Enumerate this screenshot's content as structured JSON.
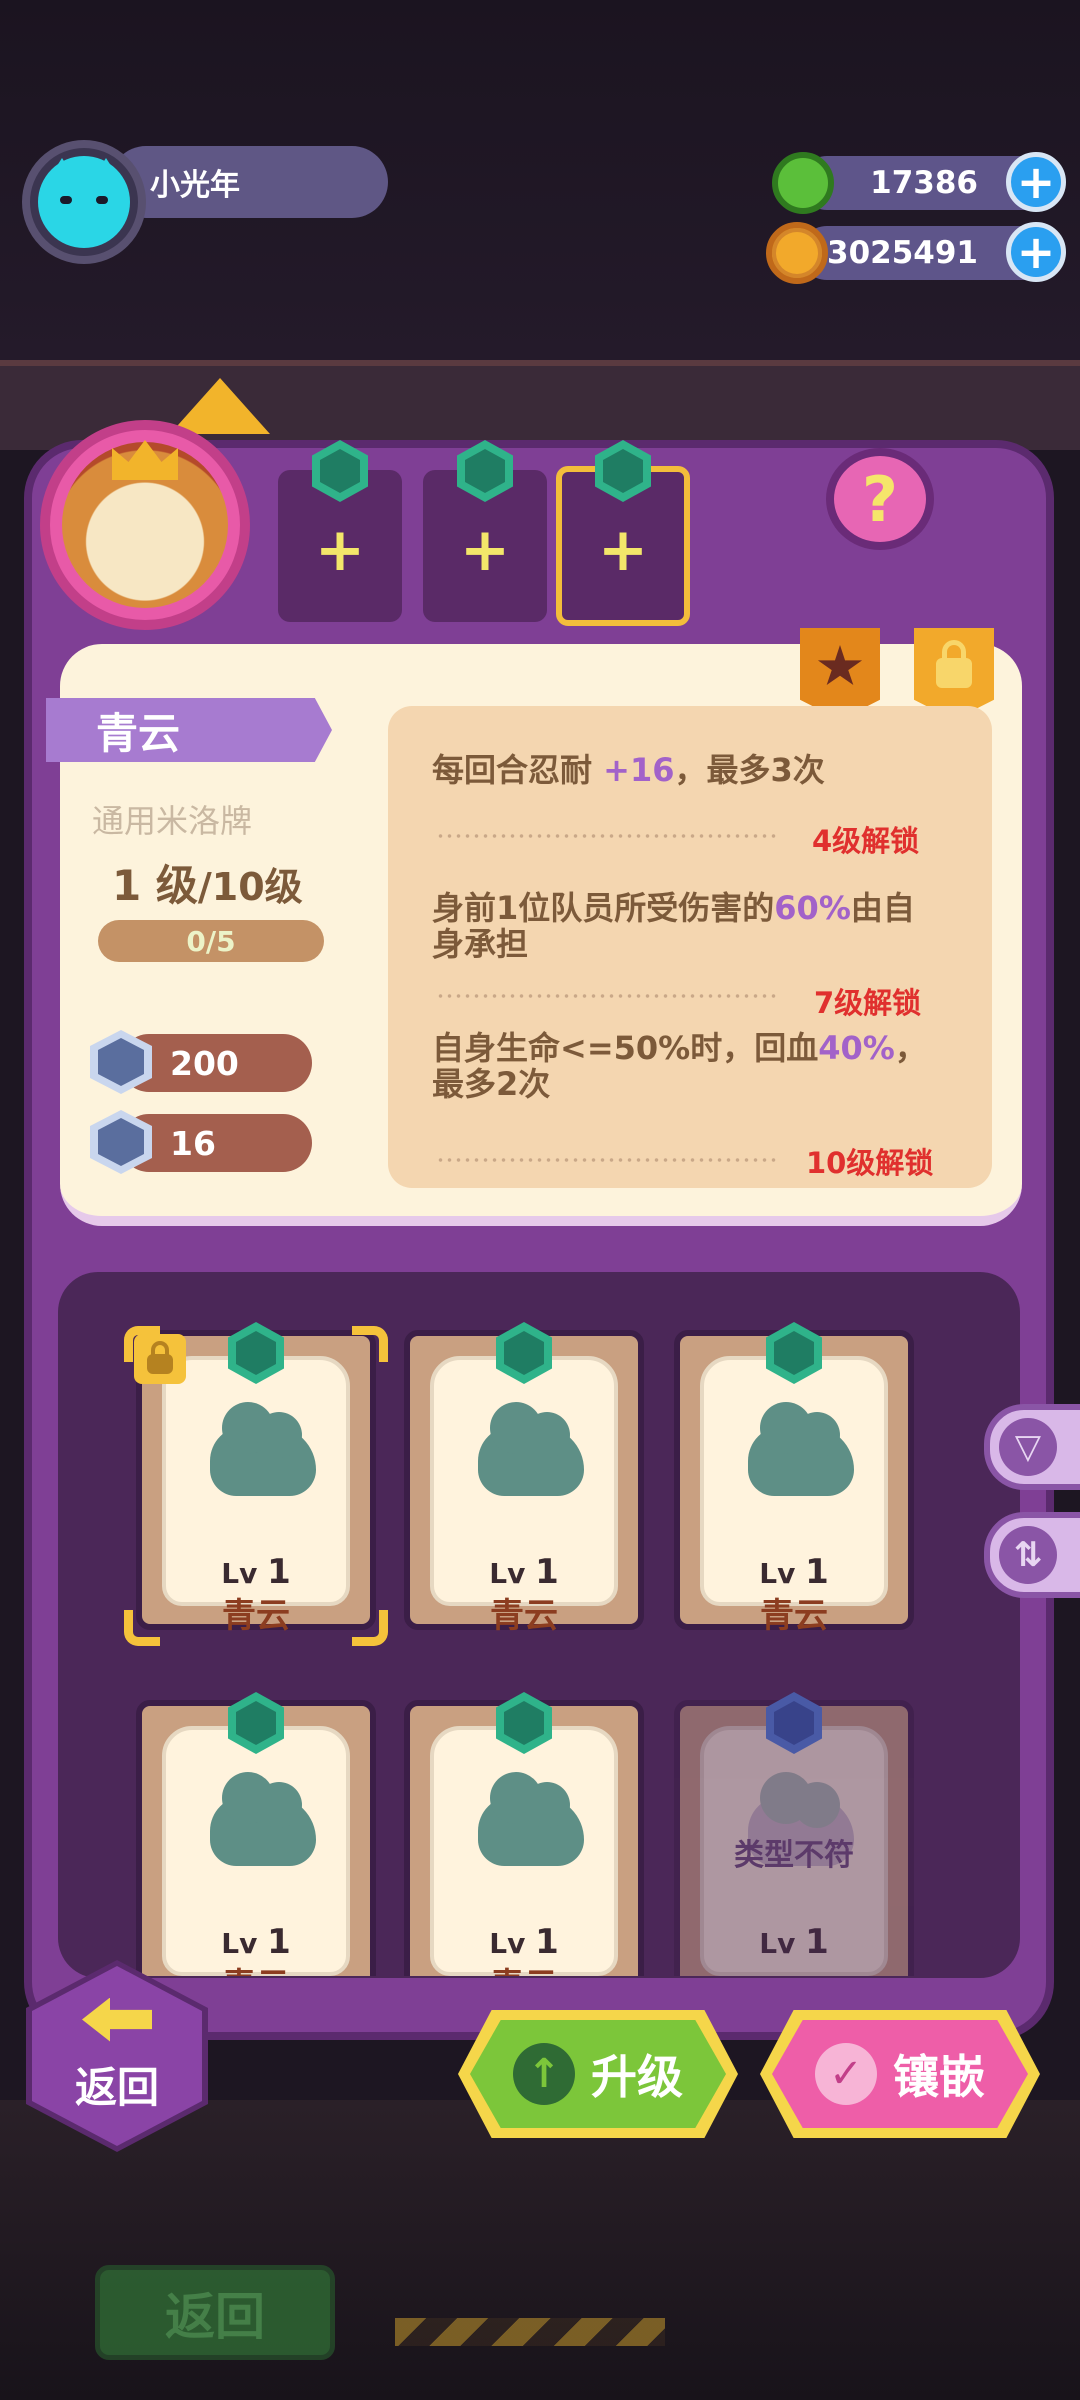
{
  "player": {
    "name": "小光年",
    "avatar_icon": "cat-avatar-icon"
  },
  "resources": [
    {
      "name": "green-gem-coin",
      "value": "17386",
      "color": "#5bbf3a"
    },
    {
      "name": "gold-planet-coin",
      "value": "3025491",
      "color": "#f2a92b"
    }
  ],
  "hero": {
    "portrait_icon": "lion-king-portrait"
  },
  "slots": [
    {
      "icon": "green-hex-tree-icon",
      "label": "+",
      "selected": false
    },
    {
      "icon": "green-hex-leaf-icon",
      "label": "+",
      "selected": false
    },
    {
      "icon": "green-hex-shield-icon",
      "label": "+",
      "selected": true
    }
  ],
  "help": {
    "label": "?"
  },
  "card": {
    "name": "青云",
    "type": "通用米洛牌",
    "level": "1",
    "level_unit": "级",
    "level_max": "/10级",
    "exp": "0/5",
    "exp_fraction": 0,
    "stats": [
      {
        "icon": "heart-shield-icon",
        "value": "200"
      },
      {
        "icon": "defense-shield-icon",
        "value": "16"
      }
    ],
    "skills": [
      {
        "pre": "每回合忍耐 ",
        "hl": "+16",
        "post": "，最多3次",
        "unlock": "4级解锁"
      },
      {
        "pre": "身前1位队员所受伤害的",
        "hl": "60%",
        "post": "由自身承担",
        "unlock": "7级解锁"
      },
      {
        "pre": "自身生命<=50%时，回血",
        "hl": "40%",
        "post": "，最多2次",
        "unlock": "10级解锁"
      }
    ]
  },
  "inventory": [
    {
      "lv_label": "Lv",
      "lv": "1",
      "name": "青云",
      "locked": true,
      "selected": true,
      "mismatch": false
    },
    {
      "lv_label": "Lv",
      "lv": "1",
      "name": "青云",
      "locked": false,
      "selected": false,
      "mismatch": false
    },
    {
      "lv_label": "Lv",
      "lv": "1",
      "name": "青云",
      "locked": false,
      "selected": false,
      "mismatch": false
    },
    {
      "lv_label": "Lv",
      "lv": "1",
      "name": "青云",
      "locked": false,
      "selected": false,
      "mismatch": false
    },
    {
      "lv_label": "Lv",
      "lv": "1",
      "name": "青云",
      "locked": false,
      "selected": false,
      "mismatch": false
    },
    {
      "lv_label": "Lv",
      "lv": "1",
      "name": "",
      "locked": false,
      "selected": false,
      "mismatch": true,
      "mismatch_text": "类型不符"
    }
  ],
  "side": {
    "filter_icon": "filter-icon",
    "sort_icon": "sort-icon"
  },
  "buttons": {
    "back": "返回",
    "upgrade": "升级",
    "inlay": "镶嵌",
    "bg_back": "返回"
  },
  "colors": {
    "panel": "#7f3f95",
    "card_bg": "#fdf3dc",
    "highlight": "#a262c9",
    "unlock_red": "#e0302e",
    "upgrade_green": "#7cc63a",
    "inlay_pink": "#ee5ea8"
  }
}
